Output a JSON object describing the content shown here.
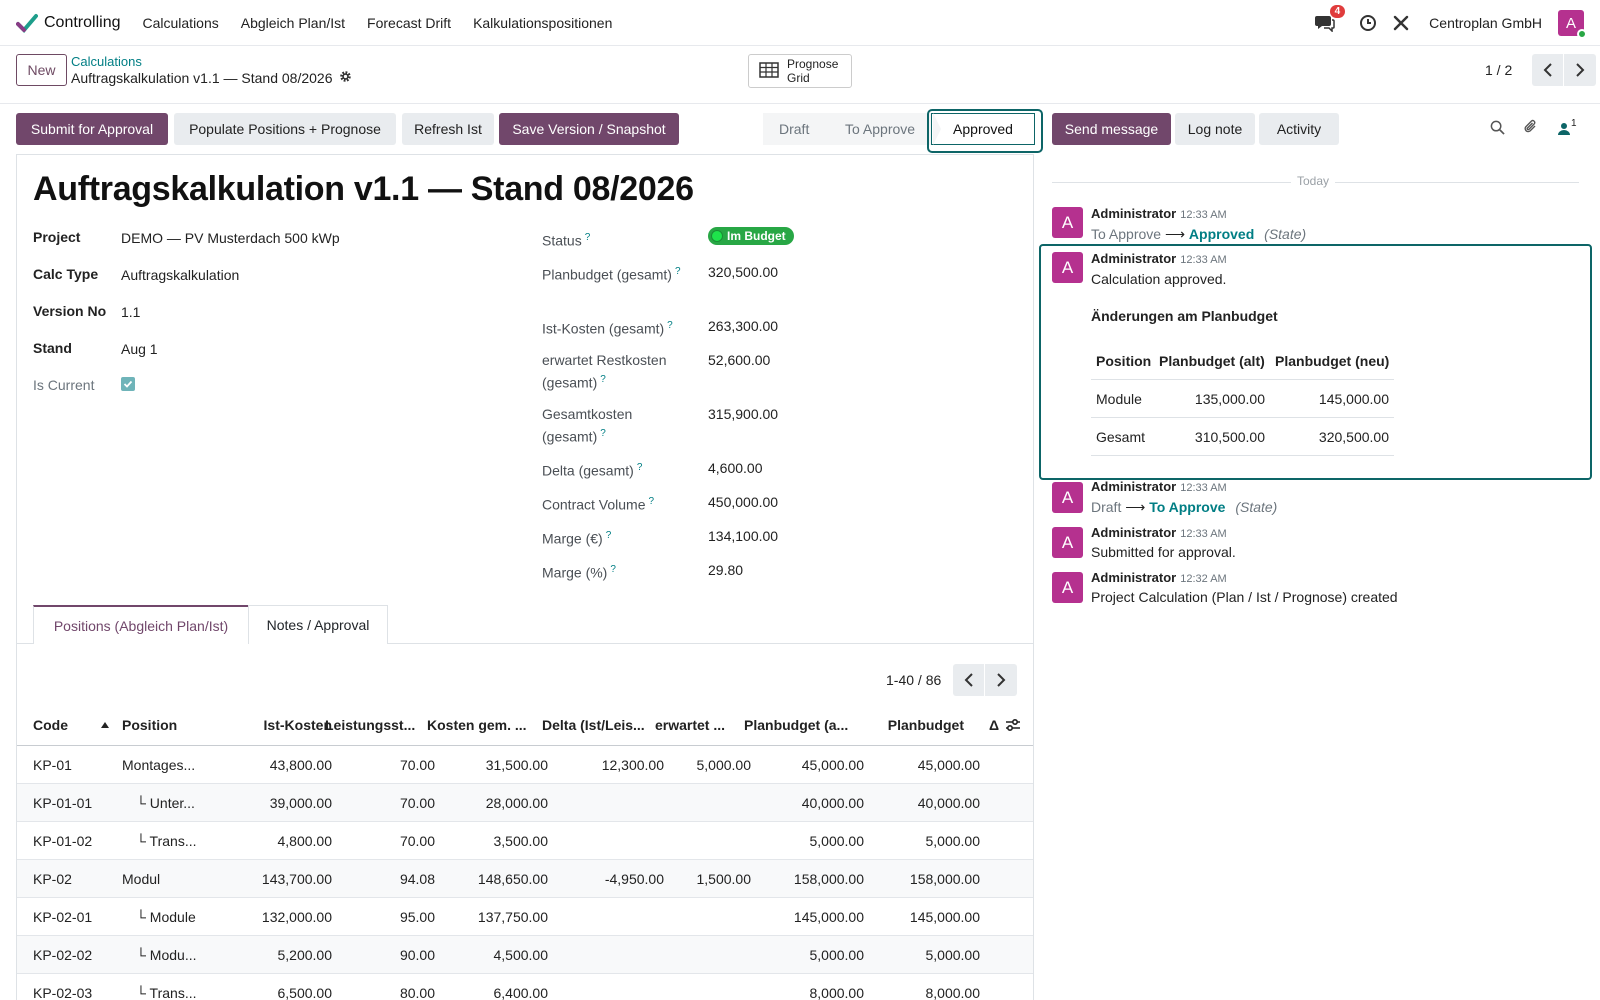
{
  "navbar": {
    "app_name": "Controlling",
    "menu": [
      "Calculations",
      "Abgleich Plan/Ist",
      "Forecast Drift",
      "Kalkulationspositionen"
    ],
    "message_badge": "4",
    "company": "Centroplan GmbH",
    "avatar_letter": "A"
  },
  "control_panel": {
    "new_label": "New",
    "breadcrumb_parent": "Calculations",
    "breadcrumb_current": "Auftragskalkulation v1.1 — Stand 08/2026",
    "prognose_grid_line1": "Prognose",
    "prognose_grid_line2": "Grid",
    "pager": "1 / 2"
  },
  "actions": {
    "submit": "Submit for Approval",
    "populate": "Populate Positions + Prognose",
    "refresh": "Refresh Ist",
    "save_version": "Save Version / Snapshot"
  },
  "statusbar": {
    "stages": [
      "Draft",
      "To Approve",
      "Approved"
    ],
    "current": "Approved"
  },
  "chatter_buttons": {
    "send_message": "Send message",
    "log_note": "Log note",
    "activity": "Activity",
    "followers_count": "1"
  },
  "form": {
    "title": "Auftragskalkulation v1.1 — Stand 08/2026",
    "left_fields": [
      {
        "label": "Project",
        "value": "DEMO — PV Musterdach 500 kWp"
      },
      {
        "label": "Calc Type",
        "value": "Auftragskalkulation"
      },
      {
        "label": "Version No",
        "value": "1.1"
      },
      {
        "label": "Stand",
        "value": "Aug 1"
      },
      {
        "label": "Is Current",
        "value": ""
      }
    ],
    "is_current_checked": true,
    "status_label": "Status",
    "status_value": "Im Budget",
    "right_fields": [
      {
        "label": "Planbudget (gesamt)",
        "value": "320,500.00"
      },
      {
        "label": "Ist-Kosten (gesamt)",
        "value": "263,300.00"
      },
      {
        "label": "erwartet Restkosten (gesamt)",
        "value": "52,600.00"
      },
      {
        "label": "Gesamtkosten (gesamt)",
        "value": "315,900.00"
      },
      {
        "label": "Delta (gesamt)",
        "value": "4,600.00"
      },
      {
        "label": "Contract Volume",
        "value": "450,000.00"
      },
      {
        "label": "Marge (€)",
        "value": "134,100.00"
      },
      {
        "label": "Marge (%)",
        "value": "29.80"
      }
    ]
  },
  "tabs": {
    "positions": "Positions (Abgleich Plan/Ist)",
    "notes": "Notes / Approval"
  },
  "list": {
    "pager": "1-40 / 86",
    "headers": [
      "Code",
      "Position",
      "Ist-Kosten",
      "Leistungsst...",
      "Kosten gem. ...",
      "Delta (Ist/Leis...",
      "erwartet ...",
      "Planbudget (a...",
      "Planbudget",
      "Δ"
    ],
    "rows": [
      [
        "KP-01",
        "Montages...",
        "43,800.00",
        "70.00",
        "31,500.00",
        "12,300.00",
        "5,000.00",
        "45,000.00",
        "45,000.00"
      ],
      [
        "KP-01-01",
        "└ Unter...",
        "39,000.00",
        "70.00",
        "28,000.00",
        "",
        "",
        "40,000.00",
        "40,000.00"
      ],
      [
        "KP-01-02",
        "└ Trans...",
        "4,800.00",
        "70.00",
        "3,500.00",
        "",
        "",
        "5,000.00",
        "5,000.00"
      ],
      [
        "KP-02",
        "Modul",
        "143,700.00",
        "94.08",
        "148,650.00",
        "-4,950.00",
        "1,500.00",
        "158,000.00",
        "158,000.00"
      ],
      [
        "KP-02-01",
        "└ Module",
        "132,000.00",
        "95.00",
        "137,750.00",
        "",
        "",
        "145,000.00",
        "145,000.00"
      ],
      [
        "KP-02-02",
        "└ Modu...",
        "5,200.00",
        "90.00",
        "4,500.00",
        "",
        "",
        "5,000.00",
        "5,000.00"
      ],
      [
        "KP-02-03",
        "└ Trans...",
        "6,500.00",
        "80.00",
        "6,400.00",
        "",
        "",
        "8,000.00",
        "8,000.00"
      ]
    ]
  },
  "chatter": {
    "today": "Today",
    "messages": [
      {
        "author": "Administrator",
        "time": "12:33 AM",
        "old": "To Approve",
        "new": "Approved",
        "field": "(State)"
      },
      {
        "author": "Administrator",
        "time": "12:33 AM",
        "body": "Calculation approved."
      },
      {
        "author": "Administrator",
        "time": "12:33 AM",
        "old": "Draft",
        "new": "To Approve",
        "field": "(State)"
      },
      {
        "author": "Administrator",
        "time": "12:33 AM",
        "body": "Submitted for approval."
      },
      {
        "author": "Administrator",
        "time": "12:32 AM",
        "body": "Project Calculation (Plan / Ist / Prognose) created"
      }
    ],
    "changes_title": "Änderungen am Planbudget",
    "changes_headers": [
      "Position",
      "Planbudget (alt)",
      "Planbudget (neu)"
    ],
    "changes_rows": [
      [
        "Module",
        "135,000.00",
        "145,000.00"
      ],
      [
        "Gesamt",
        "310,500.00",
        "320,500.00"
      ]
    ],
    "avatar_letter": "A"
  },
  "colors": {
    "primary": "#71476b",
    "link": "#017e84",
    "highlight": "#0d6567",
    "success": "#28a745",
    "avatar": "#b5318f"
  }
}
